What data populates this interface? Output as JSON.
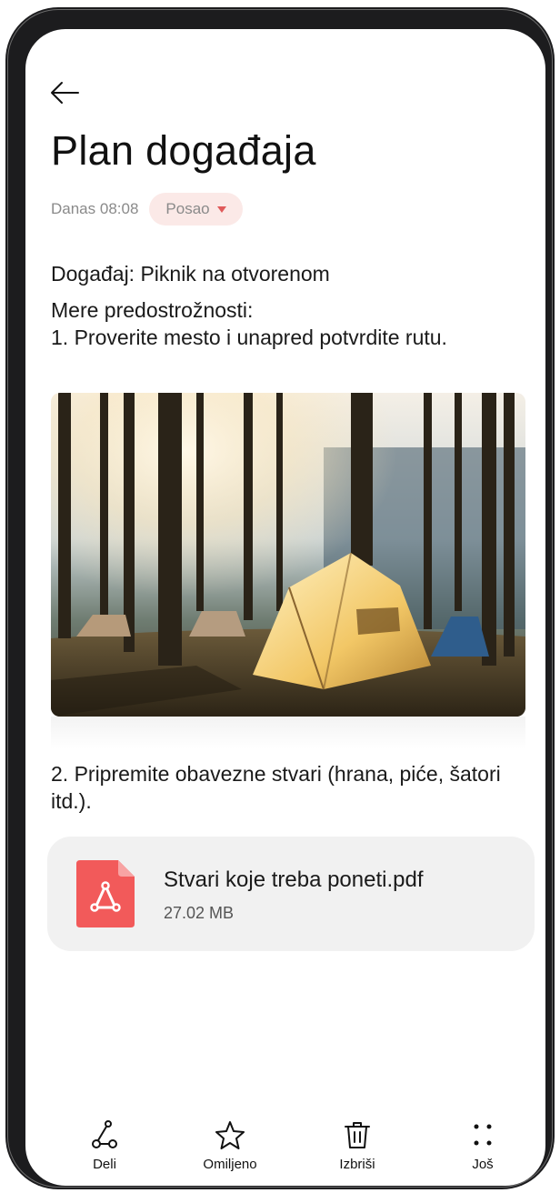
{
  "header": {
    "back_icon": "arrow-left-icon",
    "title": "Plan događaja",
    "date": "Danas 08:08",
    "category": "Posao"
  },
  "note": {
    "line1": "Događaj: Piknik na otvorenom",
    "line2": "Mere predostrožnosti:",
    "line3": "1. Proverite mesto i unapred potvrdite rutu.",
    "line4": "2. Pripremite obavezne stvari (hrana, piće, šatori itd.).",
    "image_icon": "camping-photo"
  },
  "attachment": {
    "icon": "pdf-file-icon",
    "name": "Stvari koje treba poneti.pdf",
    "size": "27.02 MB",
    "accent": "#f25a5a"
  },
  "toolbar": {
    "share": "Deli",
    "favorite": "Omiljeno",
    "delete": "Izbriši",
    "more": "Još"
  },
  "colors": {
    "tag_bg": "#fbe9e7",
    "tag_caret": "#e05a5a",
    "card_bg": "#f1f1f1"
  }
}
